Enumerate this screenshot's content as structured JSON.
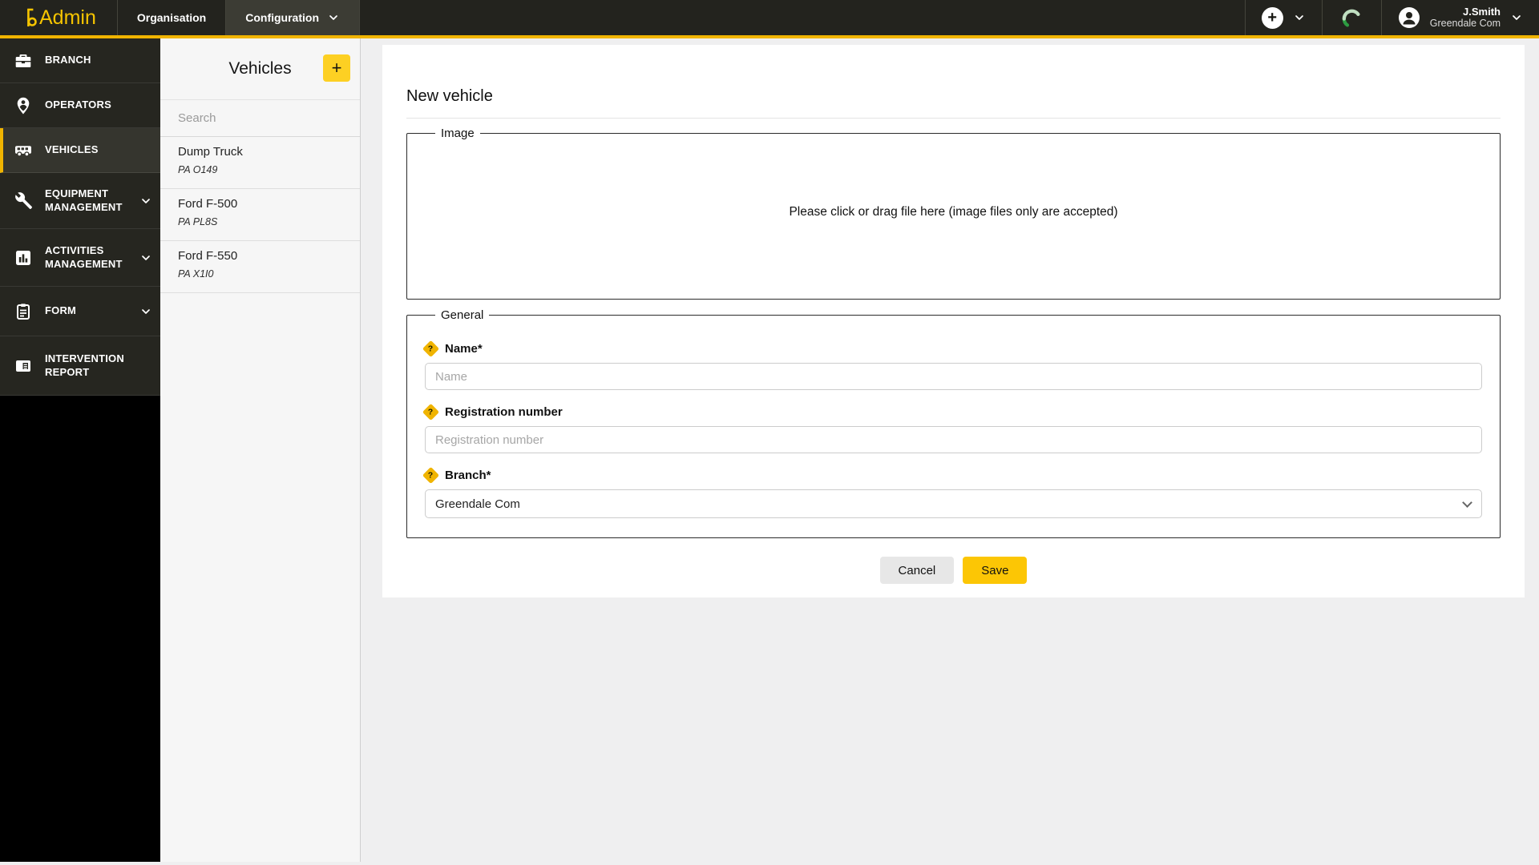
{
  "topbar": {
    "logo_text": "Admin",
    "add_glyph": "+",
    "menu": [
      {
        "label": "Organisation",
        "active": false
      },
      {
        "label": "Configuration",
        "active": true
      }
    ],
    "user": {
      "name": "J.Smith",
      "org": "Greendale Com"
    }
  },
  "sidebar": {
    "items": [
      {
        "label": "BRANCH",
        "icon": "briefcase-icon",
        "active": false,
        "has_chevron": false
      },
      {
        "label": "OPERATORS",
        "icon": "map-pin-icon",
        "active": false,
        "has_chevron": false
      },
      {
        "label": "VEHICLES",
        "icon": "truck-icon",
        "active": true,
        "has_chevron": false
      },
      {
        "label": "EQUIPMENT MANAGEMENT",
        "icon": "wrench-icon",
        "active": false,
        "has_chevron": true
      },
      {
        "label": "ACTIVITIES MANAGEMENT",
        "icon": "bar-chart-icon",
        "active": false,
        "has_chevron": true
      },
      {
        "label": "FORM",
        "icon": "clipboard-icon",
        "active": false,
        "has_chevron": true
      },
      {
        "label": "INTERVENTION REPORT",
        "icon": "report-card-icon",
        "active": false,
        "has_chevron": false
      }
    ]
  },
  "panel": {
    "title": "Vehicles",
    "add_label": "+",
    "search_placeholder": "Search",
    "vehicles": [
      {
        "name": "Dump Truck",
        "reg": "PA O149"
      },
      {
        "name": "Ford F-500",
        "reg": "PA PL8S"
      },
      {
        "name": "Ford F-550",
        "reg": "PA X1I0"
      }
    ]
  },
  "main": {
    "title": "New vehicle",
    "image": {
      "legend": "Image",
      "dropzone_text": "Please click or drag file here (image files only are accepted)"
    },
    "general": {
      "legend": "General",
      "help_glyph": "?",
      "fields": [
        {
          "label": "Name*",
          "placeholder": "Name",
          "type": "text"
        },
        {
          "label": "Registration number",
          "placeholder": "Registration number",
          "type": "text"
        },
        {
          "label": "Branch*",
          "value": "Greendale Com",
          "type": "select"
        }
      ]
    },
    "actions": {
      "cancel": "Cancel",
      "save": "Save"
    }
  },
  "colors": {
    "brand_yellow": "#f0b400",
    "button_yellow": "#fcc605",
    "add_button_yellow": "#fdd023",
    "topbar_bg": "#23231e",
    "sidebar_item_bg": "#262620",
    "gauge_green_dark": "#2d9b41",
    "gauge_green_light": "#bfdec0"
  }
}
